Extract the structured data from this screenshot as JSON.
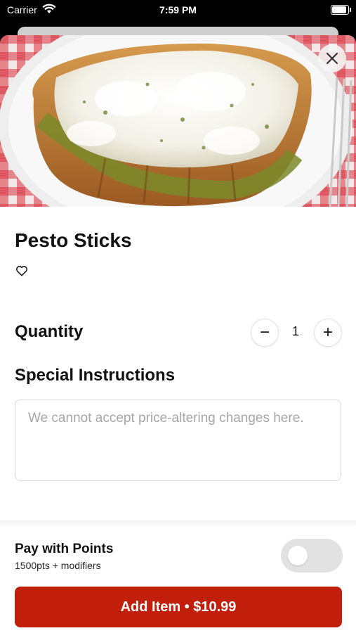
{
  "status_bar": {
    "carrier": "Carrier",
    "time": "7:59 PM"
  },
  "item": {
    "title": "Pesto Sticks"
  },
  "quantity": {
    "label": "Quantity",
    "value": "1",
    "minus": "−",
    "plus": "+"
  },
  "special_instructions": {
    "label": "Special Instructions",
    "placeholder": "We cannot accept price-altering changes here.",
    "value": ""
  },
  "points": {
    "label": "Pay with Points",
    "sub": "1500pts + modifiers",
    "enabled": false
  },
  "add_button": {
    "label": "Add Item • $10.99"
  },
  "colors": {
    "accent": "#c21e0c",
    "toggle_off": "#e2e2e2",
    "text": "#111111"
  },
  "icons": {
    "close": "close-icon",
    "favorite": "heart-outline-icon",
    "wifi": "wifi-icon",
    "battery": "battery-icon"
  }
}
